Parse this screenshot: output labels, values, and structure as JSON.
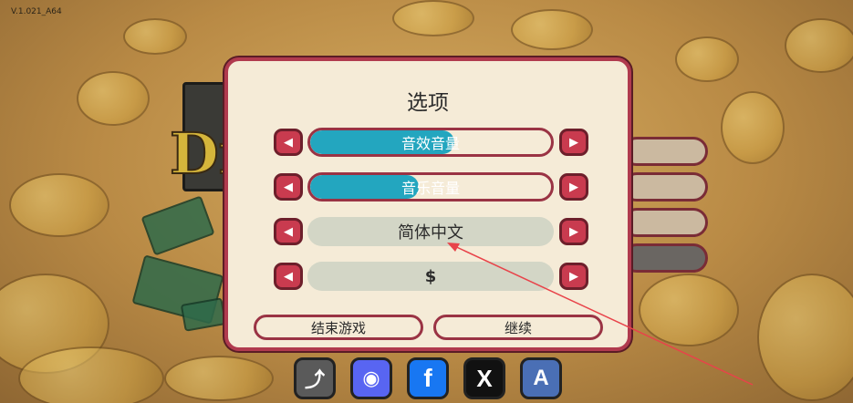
{
  "version_text": "V.1.021_A64",
  "background": {
    "logo_text": "Dr"
  },
  "dialog": {
    "title": "选项",
    "rows": [
      {
        "type": "slider",
        "label": "音效音量",
        "fill_fraction": 0.6
      },
      {
        "type": "slider",
        "label": "音乐音量",
        "fill_fraction": 0.45
      },
      {
        "type": "select",
        "value": "简体中文"
      },
      {
        "type": "select",
        "value": "$"
      }
    ],
    "arrow_left_glyph": "◀",
    "arrow_right_glyph": "▶",
    "buttons": {
      "quit_label": "结束游戏",
      "continue_label": "继续"
    }
  },
  "social": [
    {
      "icon": "share-icon",
      "glyph": "⤴",
      "color": "#5a5a5a"
    },
    {
      "icon": "discord-icon",
      "glyph": "◉",
      "color": "#5865f2"
    },
    {
      "icon": "facebook-icon",
      "glyph": "f",
      "color": "#1877f2"
    },
    {
      "icon": "x-icon",
      "glyph": "X",
      "color": "#111111"
    },
    {
      "icon": "app-store-icon",
      "glyph": "A",
      "color": "#4a6fb5"
    }
  ],
  "colors": {
    "accent_red": "#c93b4f",
    "slider_fill": "#23a6bf",
    "dialog_bg": "#f5ebd7",
    "annotation_arrow": "#e8434a"
  }
}
